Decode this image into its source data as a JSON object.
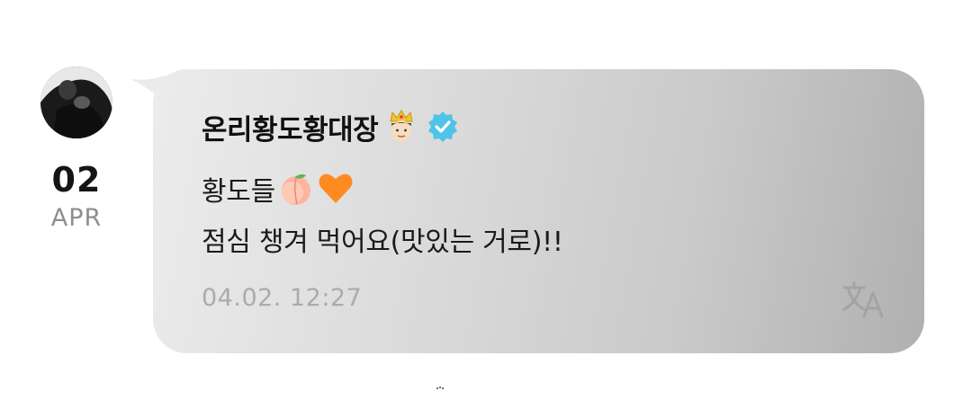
{
  "post": {
    "date_day": "02",
    "date_month": "APR",
    "sender_name": "온리황도황대장",
    "message_line1": "황도들",
    "message_line2": "점심 챙겨 먹어요(맛있는 거로)!!",
    "timestamp": "04.02. 12:27"
  },
  "icons": {
    "avatar": "profile-photo",
    "crown": "crowned-face-emoji",
    "verified": "verified-badge-icon",
    "peach": "peach-emoji",
    "heart": "orange-heart-emoji",
    "translate": "translate-icon"
  },
  "colors": {
    "verified": "#4fc3e8",
    "heart": "#ff8a1f",
    "timestamp": "#ababab"
  }
}
